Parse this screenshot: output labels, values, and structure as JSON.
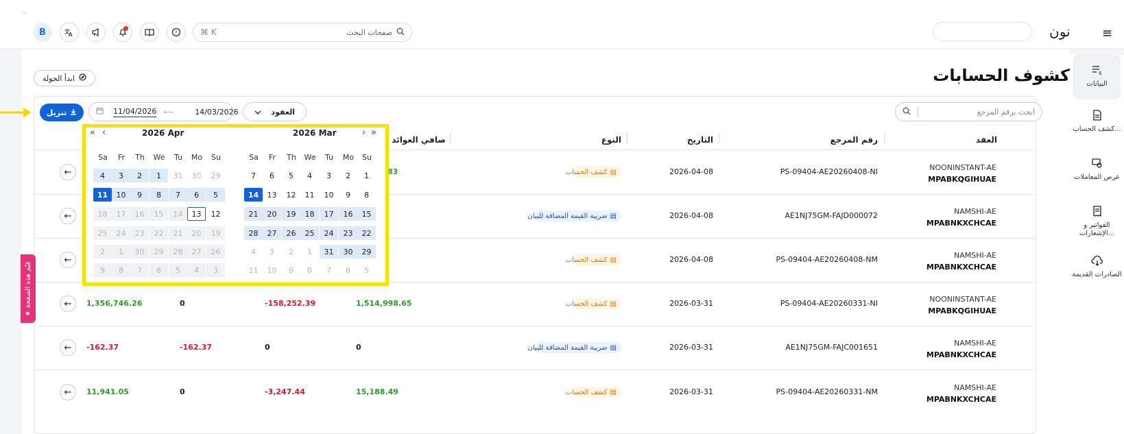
{
  "topbar": {
    "avatar_letter": "B",
    "search_placeholder": "صفحات البحث",
    "shortcut": "⌘ K",
    "logo": "نون",
    "logo_mark": "ں"
  },
  "sidebar": {
    "items": [
      {
        "label": "البيانات",
        "icon": "data-list-icon"
      },
      {
        "label": "كشف الحساب...",
        "icon": "statement-icon"
      },
      {
        "label": "عرض المعاملات",
        "icon": "transactions-icon"
      },
      {
        "label": "الفواتير و الإشعارات...",
        "icon": "invoice-icon"
      },
      {
        "label": "الصادرات القديمة",
        "icon": "cloud-download-icon"
      }
    ]
  },
  "page": {
    "title": "كشوف الحسابات",
    "tour_button": "ابدأ الجولة",
    "download_button": "تنزيل",
    "side_tab": "قيّم هذه الصفحة"
  },
  "filters": {
    "date_from": "11/04/2026",
    "date_to": "14/03/2026",
    "contract_select": "العقود",
    "ref_search_placeholder": "ابحث برقم المرجع"
  },
  "table": {
    "headers": {
      "contract": "العقد",
      "ref": "رقم المرجع",
      "date": "التاريخ",
      "type": "النوع",
      "net_revenue": "صافي العوائد"
    },
    "rows": [
      {
        "contract1": "NOONINSTANT-AE",
        "contract2": "MPABKQGIHUAE",
        "ref": "PS-09404-AE20260408-NI",
        "date": "2026-04-08",
        "type": "كشف الحساب",
        "type_color": "orange",
        "col_a": "",
        "col_b": "",
        "col_c": "",
        "col_d": "83"
      },
      {
        "contract1": "NAMSHI-AE",
        "contract2": "MPABNKXCHCAE",
        "ref": "AE1NJ75GM-FAJD000072",
        "date": "2026-04-08",
        "type": "ضريبة القيمة المضافة للبيان",
        "type_color": "blue",
        "col_a": "",
        "col_b": "",
        "col_c": "",
        "col_d": ""
      },
      {
        "contract1": "NAMSHI-AE",
        "contract2": "MPABNKXCHCAE",
        "ref": "PS-09404-AE20260408-NM",
        "date": "2026-04-08",
        "type": "كشف الحساب",
        "type_color": "orange",
        "col_a": "",
        "col_b": "",
        "col_c": "",
        "col_d": ""
      },
      {
        "contract1": "NOONINSTANT-AE",
        "contract2": "MPABKQGIHUAE",
        "ref": "PS-09404-AE20260331-NI",
        "date": "2026-03-31",
        "type": "كشف الحساب",
        "type_color": "orange",
        "col_a": "1,356,746.26",
        "col_b": "0",
        "col_c": "-158,252.39",
        "col_d": "1,514,998.65"
      },
      {
        "contract1": "NAMSHI-AE",
        "contract2": "MPABNKXCHCAE",
        "ref": "AE1NJ75GM-FAJC001651",
        "date": "2026-03-31",
        "type": "ضريبة القيمة المضافة للبيان",
        "type_color": "blue",
        "col_a": "-162.37",
        "col_b": "-162.37",
        "col_c": "0",
        "col_d": "0"
      },
      {
        "contract1": "NAMSHI-AE",
        "contract2": "MPABNKXCHCAE",
        "ref": "PS-09404-AE20260331-NM",
        "date": "2026-03-31",
        "type": "كشف الحساب",
        "type_color": "orange",
        "col_a": "11,941.05",
        "col_b": "0",
        "col_c": "-3,247.44",
        "col_d": "15,188.49"
      }
    ]
  },
  "calendar": {
    "left_title": "2026  Apr",
    "right_title": "2026  Mar",
    "weekdays": [
      "Sa",
      "Fr",
      "Th",
      "We",
      "Tu",
      "Mo",
      "Su"
    ],
    "left_weeks": [
      [
        "4",
        "3",
        "2",
        "1",
        "31",
        "30",
        "29"
      ],
      [
        "11",
        "10",
        "9",
        "8",
        "7",
        "6",
        "5"
      ],
      [
        "18",
        "17",
        "16",
        "15",
        "14",
        "13",
        "12"
      ],
      [
        "25",
        "24",
        "23",
        "22",
        "21",
        "20",
        "19"
      ],
      [
        "2",
        "1",
        "30",
        "29",
        "28",
        "27",
        "26"
      ],
      [
        "9",
        "8",
        "7",
        "6",
        "5",
        "4",
        "3"
      ]
    ],
    "right_weeks": [
      [
        "7",
        "6",
        "5",
        "4",
        "3",
        "2",
        "1"
      ],
      [
        "14",
        "13",
        "12",
        "11",
        "10",
        "9",
        "8"
      ],
      [
        "21",
        "20",
        "19",
        "18",
        "17",
        "16",
        "15"
      ],
      [
        "28",
        "27",
        "26",
        "25",
        "24",
        "23",
        "22"
      ],
      [
        "4",
        "3",
        "2",
        "1",
        "31",
        "30",
        "29"
      ],
      [
        "11",
        "10",
        "9",
        "8",
        "7",
        "6",
        "5"
      ]
    ]
  },
  "colors": {
    "primary": "#1463d6",
    "highlight": "#f7e100",
    "positive": "#2c9b2a",
    "negative": "#d0192d",
    "side_tab": "#e43479"
  }
}
